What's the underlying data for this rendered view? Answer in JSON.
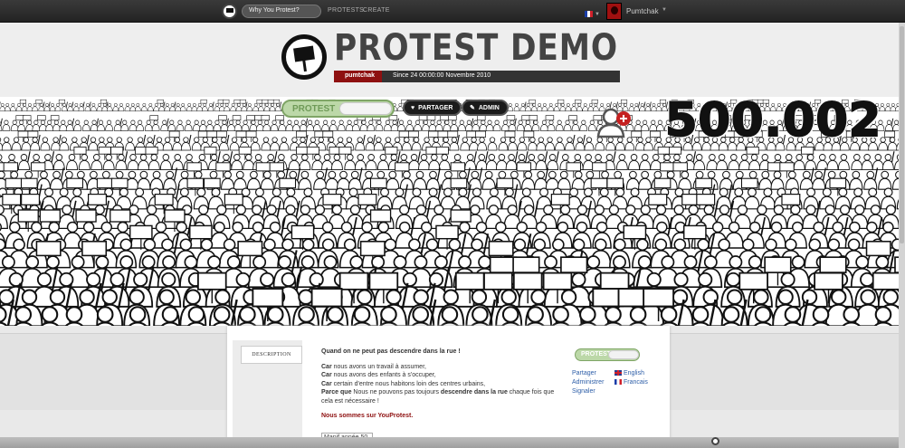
{
  "topbar": {
    "search_placeholder": "Why You Protest?",
    "nav": [
      "PROTESTS",
      "CREATE"
    ],
    "username": "Pumtchak"
  },
  "header": {
    "title": "PROTEST DEMO",
    "owner": "pumtchak",
    "since": "Since 24 00:00:00 Novembre 2010"
  },
  "actions": {
    "protest_toggle": "PROTEST",
    "share": "PARTAGER",
    "admin": "ADMIN",
    "counter": "500.002"
  },
  "panel": {
    "tab": "DESCRIPTION",
    "heading": "Quand on ne peut pas descendre dans la rue !",
    "lines": [
      {
        "bold": "Car",
        "rest": " nous avons un travail à assumer,"
      },
      {
        "bold": "Car",
        "rest": " nous avons des enfants à s'occuper,"
      },
      {
        "bold": "Car",
        "rest": " certain d'entre nous habitons loin des centres urbains,"
      }
    ],
    "last_bold": "Parce que",
    "last_mid": " Nous ne pouvons pas toujours ",
    "last_bold2": "descendre dans la rue",
    "last_tail": " chaque fois que cela est nécessaire !",
    "closing": "Nous sommes sur YouProtest.",
    "image_alt": "Manif année 50",
    "mini_toggle": "PROTEST",
    "links": [
      "Partager",
      "Administrer",
      "Signaler"
    ],
    "languages": [
      "English",
      "Francais"
    ]
  },
  "colors": {
    "accent_red": "#8e1010",
    "toggle_green": "#bcd8a8",
    "link_blue": "#2d5ea8"
  }
}
